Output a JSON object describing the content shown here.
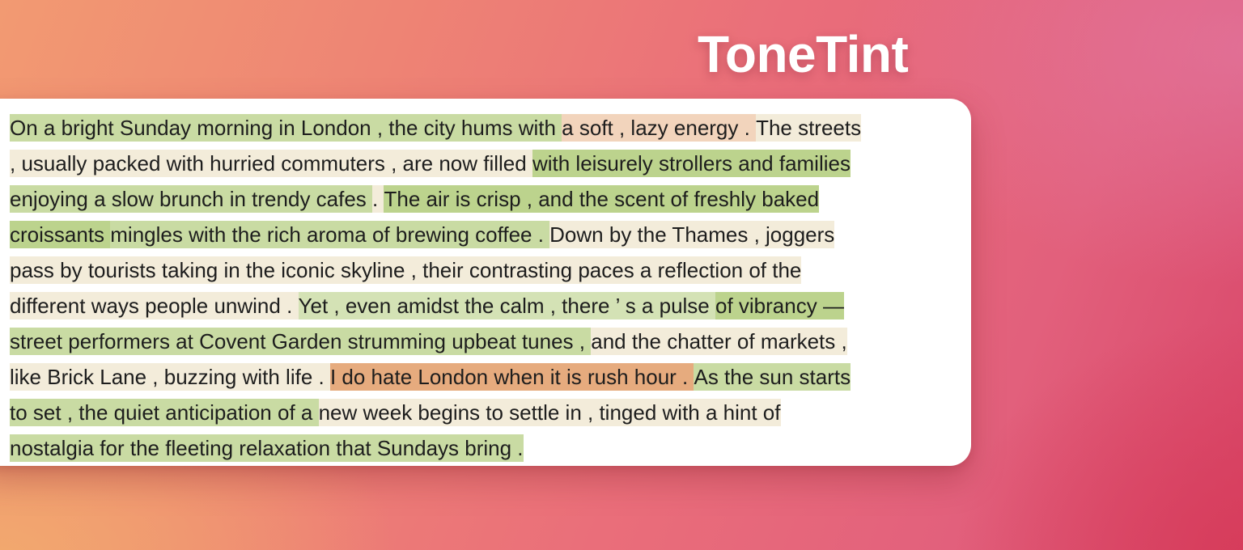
{
  "app": {
    "title": "ToneTint"
  },
  "palette": {
    "pos1": "#c9dba3",
    "pos2": "#bcd38d",
    "pos3": "#d4e2b5",
    "neutral": "#f3ecda",
    "neg1": "#f2d4bc",
    "neg2": "#e6ab7e"
  },
  "passage": {
    "lines": [
      [
        {
          "text": "On a bright Sunday morning in London , the city hums with ",
          "tone": "pos1"
        },
        {
          "text": "a soft , lazy energy . ",
          "tone": "neg1"
        },
        {
          "text": "The streets",
          "tone": "neutral"
        }
      ],
      [
        {
          "text": ", usually packed with hurried commuters , are now filled ",
          "tone": "neutral"
        },
        {
          "text": "with leisurely strollers and families",
          "tone": "pos2"
        }
      ],
      [
        {
          "text": "enjoying a slow brunch in trendy cafes ",
          "tone": "pos1"
        },
        {
          "text": ". ",
          "tone": "neutral"
        },
        {
          "text": "The air is crisp , and the scent of freshly baked",
          "tone": "pos2"
        }
      ],
      [
        {
          "text": "croissants ",
          "tone": "pos2"
        },
        {
          "text": "mingles with the rich aroma of brewing coffee . ",
          "tone": "pos1"
        },
        {
          "text": "Down by the Thames , joggers",
          "tone": "neutral"
        }
      ],
      [
        {
          "text": "pass by tourists taking in the iconic skyline , their contrasting paces a reflection of the",
          "tone": "neutral"
        }
      ],
      [
        {
          "text": "different ways people unwind . ",
          "tone": "neutral"
        },
        {
          "text": "Yet , even amidst the calm , there ’ s a pulse ",
          "tone": "pos3"
        },
        {
          "text": "of vibrancy —",
          "tone": "pos2"
        }
      ],
      [
        {
          "text": "street performers at Covent Garden strumming upbeat tunes , ",
          "tone": "pos1"
        },
        {
          "text": "and the chatter of markets ,",
          "tone": "neutral"
        }
      ],
      [
        {
          "text": "like Brick Lane , buzzing with life . ",
          "tone": "neutral"
        },
        {
          "text": "I do hate London when it is rush hour . ",
          "tone": "neg2"
        },
        {
          "text": "As the sun starts",
          "tone": "pos1"
        }
      ],
      [
        {
          "text": "to set , the quiet anticipation of a ",
          "tone": "pos1"
        },
        {
          "text": "new week begins to settle in , tinged with a hint of",
          "tone": "neutral"
        }
      ],
      [
        {
          "text": "nostalgia for the fleeting relaxation that Sundays bring .",
          "tone": "pos1"
        }
      ]
    ]
  }
}
